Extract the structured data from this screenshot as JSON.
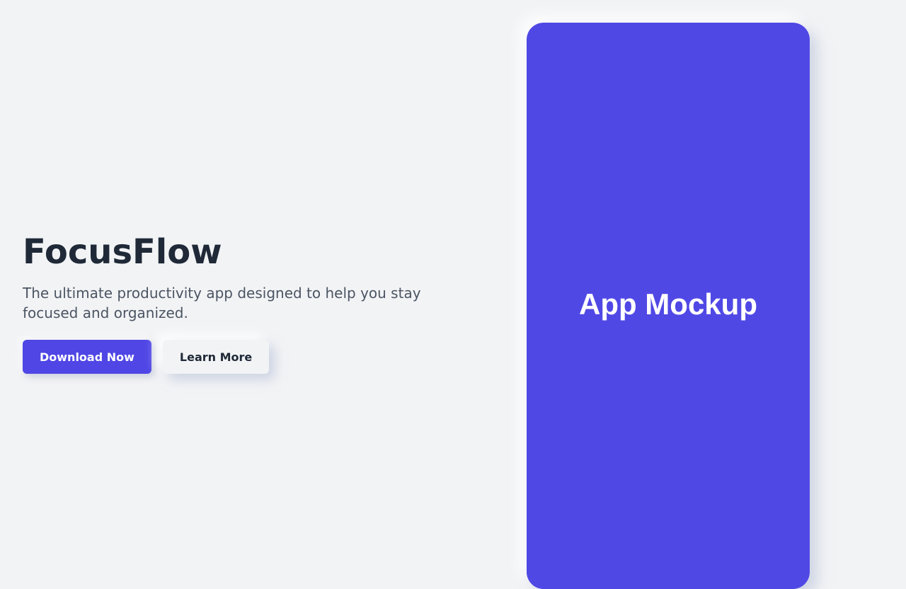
{
  "hero": {
    "title": "FocusFlow",
    "subtitle": "The ultimate productivity app designed to help you stay focused and organized.",
    "primary_button": "Download Now",
    "secondary_button": "Learn More"
  },
  "mockup": {
    "label": "App Mockup"
  },
  "colors": {
    "accent": "#4f46e5",
    "background": "#f2f3f5",
    "heading": "#1f2937",
    "body_text": "#4b5563"
  }
}
